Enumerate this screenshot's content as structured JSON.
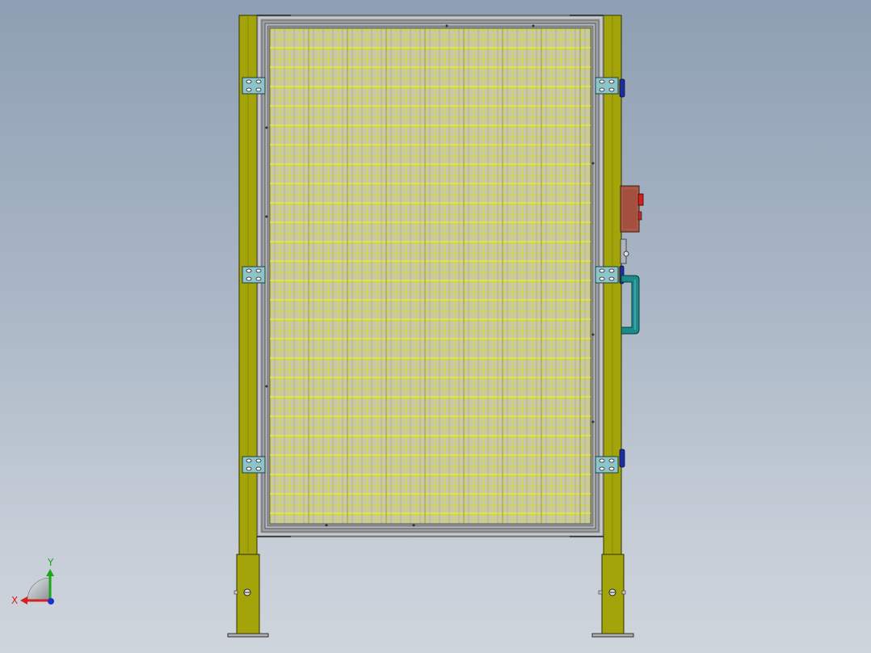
{
  "view": {
    "background_top": "#8e9fb3",
    "background_bottom": "#cfd5dc"
  },
  "model": {
    "post_color": "#a3a30a",
    "frame_color": "#a9acae",
    "mesh_color": "#d6d633",
    "mesh_background": "#c9c9a4",
    "hinge_color": "#8cc4c9",
    "handle_color": "#1d8a8a",
    "lock_box_color": "#a3503f",
    "blue_stop_color": "#1a2ea0"
  },
  "triad": {
    "x_label": "X",
    "y_label": "Y",
    "x_color": "#d42020",
    "y_color": "#1aa81a",
    "z_color": "#2030c8"
  }
}
